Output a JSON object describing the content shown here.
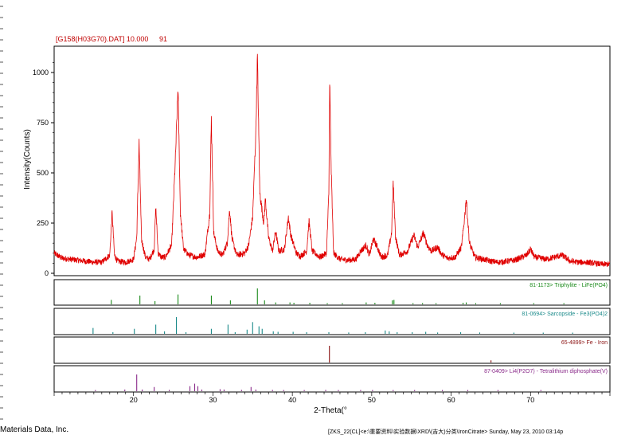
{
  "header": {
    "file_label": "[G158(H03G70).DAT] 10.000",
    "count_label": "91"
  },
  "footer": {
    "company": "Materials Data, Inc.",
    "path_info": "[ZKS_22(CL]<e:\\重要资料\\实验数据\\XRD\\(吉大)分类\\IronCitrate> Sunday, May 23, 2010 03:14p"
  },
  "colors": {
    "pattern": "#e00000",
    "ref1": "#1a8a1a",
    "ref2": "#1a8a8a",
    "ref3": "#8a1010",
    "ref4": "#8a2a8a"
  },
  "chart_data": {
    "type": "line",
    "title": "",
    "xlabel": "2-Theta(°",
    "ylabel": "Intensity(Counts)",
    "xlim": [
      10,
      80
    ],
    "ylim": [
      0,
      1100
    ],
    "x_ticks": [
      20,
      30,
      40,
      50,
      60,
      70
    ],
    "y_ticks": [
      0,
      250,
      500,
      750,
      1000
    ],
    "series": [
      {
        "points": [
          [
            10,
            100
          ],
          [
            11,
            75
          ],
          [
            12,
            70
          ],
          [
            13,
            65
          ],
          [
            14,
            60
          ],
          [
            15,
            55
          ],
          [
            16,
            55
          ],
          [
            17,
            90
          ],
          [
            17.3,
            300
          ],
          [
            17.6,
            90
          ],
          [
            18,
            60
          ],
          [
            19,
            55
          ],
          [
            20,
            70
          ],
          [
            20.4,
            180
          ],
          [
            20.7,
            650
          ],
          [
            21,
            170
          ],
          [
            21.5,
            80
          ],
          [
            22,
            70
          ],
          [
            22.6,
            120
          ],
          [
            22.8,
            330
          ],
          [
            23.1,
            100
          ],
          [
            23.5,
            80
          ],
          [
            24,
            80
          ],
          [
            24.8,
            140
          ],
          [
            25.3,
            600
          ],
          [
            25.6,
            930
          ],
          [
            25.9,
            300
          ],
          [
            26.3,
            120
          ],
          [
            27,
            90
          ],
          [
            28,
            80
          ],
          [
            29,
            95
          ],
          [
            29.6,
            300
          ],
          [
            29.8,
            770
          ],
          [
            30.1,
            200
          ],
          [
            30.6,
            110
          ],
          [
            31.2,
            90
          ],
          [
            31.8,
            150
          ],
          [
            32.1,
            320
          ],
          [
            32.4,
            170
          ],
          [
            33,
            90
          ],
          [
            34,
            100
          ],
          [
            34.5,
            140
          ],
          [
            35,
            280
          ],
          [
            35.4,
            700
          ],
          [
            35.6,
            1080
          ],
          [
            35.9,
            400
          ],
          [
            36.4,
            250
          ],
          [
            36.6,
            370
          ],
          [
            37,
            180
          ],
          [
            37.5,
            110
          ],
          [
            37.9,
            210
          ],
          [
            38.3,
            110
          ],
          [
            39,
            120
          ],
          [
            39.5,
            280
          ],
          [
            39.8,
            190
          ],
          [
            40.5,
            100
          ],
          [
            41,
            85
          ],
          [
            41.8,
            110
          ],
          [
            42.1,
            260
          ],
          [
            42.5,
            110
          ],
          [
            43.5,
            80
          ],
          [
            44.3,
            100
          ],
          [
            44.6,
            400
          ],
          [
            44.7,
            970
          ],
          [
            44.9,
            500
          ],
          [
            45.2,
            100
          ],
          [
            46,
            70
          ],
          [
            47,
            65
          ],
          [
            48,
            70
          ],
          [
            48.6,
            110
          ],
          [
            49.3,
            140
          ],
          [
            49.7,
            90
          ],
          [
            50.2,
            170
          ],
          [
            50.6,
            140
          ],
          [
            51.2,
            80
          ],
          [
            52,
            90
          ],
          [
            52.5,
            200
          ],
          [
            52.7,
            450
          ],
          [
            53,
            180
          ],
          [
            53.5,
            90
          ],
          [
            54.5,
            110
          ],
          [
            55,
            160
          ],
          [
            55.3,
            190
          ],
          [
            55.8,
            130
          ],
          [
            56.5,
            200
          ],
          [
            57,
            140
          ],
          [
            57.5,
            110
          ],
          [
            58.3,
            130
          ],
          [
            58.8,
            95
          ],
          [
            59.5,
            75
          ],
          [
            60.5,
            80
          ],
          [
            61.3,
            130
          ],
          [
            61.7,
            280
          ],
          [
            61.9,
            375
          ],
          [
            62.3,
            150
          ],
          [
            63,
            80
          ],
          [
            64,
            70
          ],
          [
            65,
            60
          ],
          [
            66,
            55
          ],
          [
            67,
            60
          ],
          [
            68,
            65
          ],
          [
            69.5,
            90
          ],
          [
            70,
            120
          ],
          [
            70.5,
            80
          ],
          [
            72,
            70
          ],
          [
            73,
            80
          ],
          [
            74,
            90
          ],
          [
            75,
            60
          ],
          [
            76,
            55
          ],
          [
            77,
            55
          ],
          [
            78,
            50
          ],
          [
            79,
            45
          ],
          [
            80,
            45
          ]
        ]
      }
    ],
    "references": [
      {
        "label": "81-1173> Triphylite - LiFe(PO4)",
        "peaks": [
          [
            17.2,
            0.28
          ],
          [
            20.8,
            0.55
          ],
          [
            22.7,
            0.2
          ],
          [
            25.6,
            0.62
          ],
          [
            29.8,
            0.55
          ],
          [
            32.2,
            0.25
          ],
          [
            35.6,
            1.0
          ],
          [
            36.5,
            0.25
          ],
          [
            37.9,
            0.12
          ],
          [
            39.7,
            0.12
          ],
          [
            40.2,
            0.1
          ],
          [
            42.2,
            0.1
          ],
          [
            44.4,
            0.06
          ],
          [
            46.3,
            0.06
          ],
          [
            49.3,
            0.12
          ],
          [
            50.4,
            0.1
          ],
          [
            52.6,
            0.25
          ],
          [
            52.8,
            0.28
          ],
          [
            55.2,
            0.06
          ],
          [
            56.4,
            0.08
          ],
          [
            58.1,
            0.06
          ],
          [
            61.5,
            0.1
          ],
          [
            61.9,
            0.12
          ],
          [
            63.1,
            0.06
          ],
          [
            66.2,
            0.05
          ],
          [
            70.4,
            0.06
          ],
          [
            74.2,
            0.06
          ]
        ]
      },
      {
        "label": "81-0694> Sarcopside - Fe3(PO4)2",
        "peaks": [
          [
            14.9,
            0.35
          ],
          [
            17.4,
            0.1
          ],
          [
            20.1,
            0.3
          ],
          [
            22.8,
            0.55
          ],
          [
            23.9,
            0.15
          ],
          [
            25.4,
            1.0
          ],
          [
            26.6,
            0.1
          ],
          [
            29.8,
            0.3
          ],
          [
            31.9,
            0.55
          ],
          [
            32.8,
            0.1
          ],
          [
            34.3,
            0.25
          ],
          [
            35.0,
            0.7
          ],
          [
            35.8,
            0.45
          ],
          [
            36.2,
            0.3
          ],
          [
            37.6,
            0.15
          ],
          [
            38.2,
            0.12
          ],
          [
            40.1,
            0.12
          ],
          [
            41.8,
            0.1
          ],
          [
            44.6,
            0.1
          ],
          [
            47.1,
            0.08
          ],
          [
            49.2,
            0.1
          ],
          [
            51.7,
            0.2
          ],
          [
            52.2,
            0.15
          ],
          [
            53.2,
            0.1
          ],
          [
            55.1,
            0.1
          ],
          [
            56.8,
            0.12
          ],
          [
            58.3,
            0.08
          ],
          [
            61.2,
            0.1
          ],
          [
            63.6,
            0.08
          ],
          [
            67.9,
            0.05
          ],
          [
            71.6,
            0.06
          ],
          [
            75.3,
            0.05
          ]
        ]
      },
      {
        "label": "65-4899> Fe - Iron",
        "peaks": [
          [
            44.67,
            1.0
          ],
          [
            65.02,
            0.13
          ]
        ]
      },
      {
        "label": "87-0409> Li4(P2O7) - Tetralithium diphosphate(V)",
        "peaks": [
          [
            15.2,
            0.05
          ],
          [
            18.9,
            0.1
          ],
          [
            20.4,
            1.0
          ],
          [
            21.1,
            0.1
          ],
          [
            22.6,
            0.25
          ],
          [
            24.5,
            0.08
          ],
          [
            27.1,
            0.3
          ],
          [
            27.7,
            0.45
          ],
          [
            28.1,
            0.3
          ],
          [
            28.6,
            0.1
          ],
          [
            30.9,
            0.12
          ],
          [
            31.4,
            0.1
          ],
          [
            33.6,
            0.08
          ],
          [
            34.8,
            0.25
          ],
          [
            35.4,
            0.1
          ],
          [
            37.5,
            0.08
          ],
          [
            38.9,
            0.06
          ],
          [
            41.5,
            0.06
          ],
          [
            44.2,
            0.08
          ],
          [
            45.8,
            0.06
          ],
          [
            48.6,
            0.06
          ],
          [
            50.1,
            0.06
          ],
          [
            52.7,
            0.06
          ],
          [
            55.4,
            0.05
          ],
          [
            58.9,
            0.05
          ],
          [
            62.1,
            0.05
          ],
          [
            65.9,
            0.05
          ],
          [
            71.3,
            0.05
          ]
        ]
      }
    ]
  }
}
